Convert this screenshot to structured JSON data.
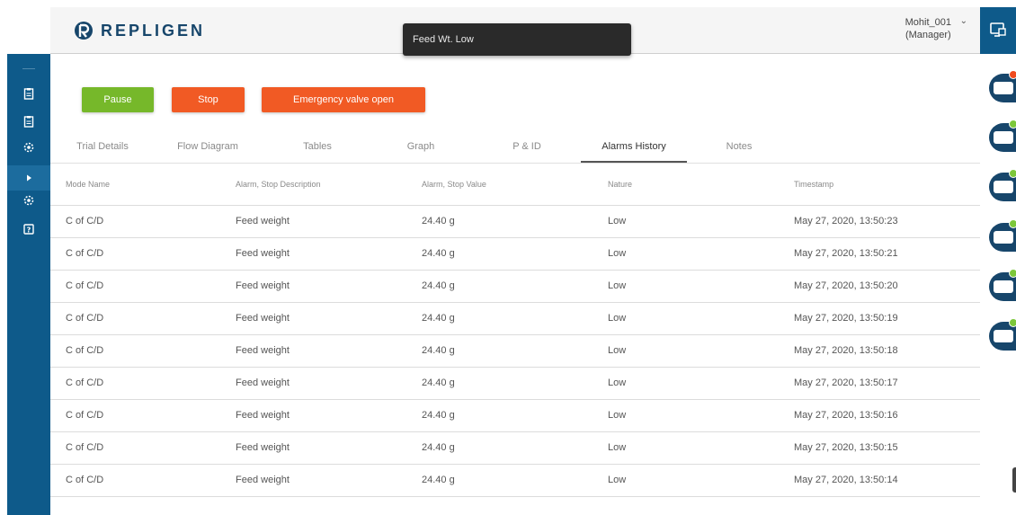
{
  "header": {
    "logo_text": "REPLIGEN",
    "user_name": "Mohit_001",
    "user_role": "(Manager)"
  },
  "toast": {
    "message": "Feed Wt. Low"
  },
  "actions": {
    "pause": "Pause",
    "stop": "Stop",
    "emergency": "Emergency valve open"
  },
  "tabs": [
    {
      "label": "Trial Details"
    },
    {
      "label": "Flow Diagram"
    },
    {
      "label": "Tables"
    },
    {
      "label": "Graph"
    },
    {
      "label": "P & ID"
    },
    {
      "label": "Alarms History",
      "active": true
    },
    {
      "label": "Notes"
    }
  ],
  "table": {
    "columns": [
      "Mode Name",
      "Alarm, Stop Description",
      "Alarm, Stop Value",
      "Nature",
      "Timestamp"
    ],
    "rows": [
      [
        "C of C/D",
        "Feed weight",
        "24.40 g",
        "Low",
        "May 27, 2020, 13:50:23"
      ],
      [
        "C of C/D",
        "Feed weight",
        "24.40 g",
        "Low",
        "May 27, 2020, 13:50:21"
      ],
      [
        "C of C/D",
        "Feed weight",
        "24.40 g",
        "Low",
        "May 27, 2020, 13:50:20"
      ],
      [
        "C of C/D",
        "Feed weight",
        "24.40 g",
        "Low",
        "May 27, 2020, 13:50:19"
      ],
      [
        "C of C/D",
        "Feed weight",
        "24.40 g",
        "Low",
        "May 27, 2020, 13:50:18"
      ],
      [
        "C of C/D",
        "Feed weight",
        "24.40 g",
        "Low",
        "May 27, 2020, 13:50:17"
      ],
      [
        "C of C/D",
        "Feed weight",
        "24.40 g",
        "Low",
        "May 27, 2020, 13:50:16"
      ],
      [
        "C of C/D",
        "Feed weight",
        "24.40 g",
        "Low",
        "May 27, 2020, 13:50:15"
      ],
      [
        "C of C/D",
        "Feed weight",
        "24.40 g",
        "Low",
        "May 27, 2020, 13:50:14"
      ]
    ]
  },
  "colors": {
    "brand_blue": "#0e5a8a",
    "pause_green": "#76b82a",
    "stop_orange": "#f15a24",
    "ok_green": "#7cc73a",
    "error_red": "#f04b1f"
  },
  "left_nav_icons": [
    "clipboard-icon",
    "clipboard-icon",
    "settings-gear-icon",
    "play-icon",
    "settings-gear-icon",
    "help-icon"
  ],
  "right_rail_devices": [
    {
      "icon": "device-icon",
      "status": "error"
    },
    {
      "icon": "device-icon",
      "status": "ok"
    },
    {
      "icon": "device-icon",
      "status": "ok"
    },
    {
      "icon": "device-icon",
      "status": "ok"
    },
    {
      "icon": "device-icon",
      "status": "ok"
    },
    {
      "icon": "device-icon",
      "status": "ok"
    }
  ]
}
